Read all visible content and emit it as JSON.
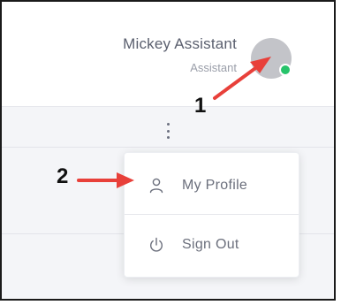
{
  "header": {
    "user_name": "Mickey Assistant",
    "user_role": "Assistant",
    "status": "online"
  },
  "menu": {
    "items": [
      {
        "label": "My Profile",
        "icon": "user-icon"
      },
      {
        "label": "Sign Out",
        "icon": "power-icon"
      }
    ]
  },
  "annotations": {
    "step1": "1",
    "step2": "2"
  },
  "colors": {
    "status_online": "#27c36a",
    "annotation_arrow": "#e8403a",
    "avatar_placeholder": "#c3c4c9"
  }
}
